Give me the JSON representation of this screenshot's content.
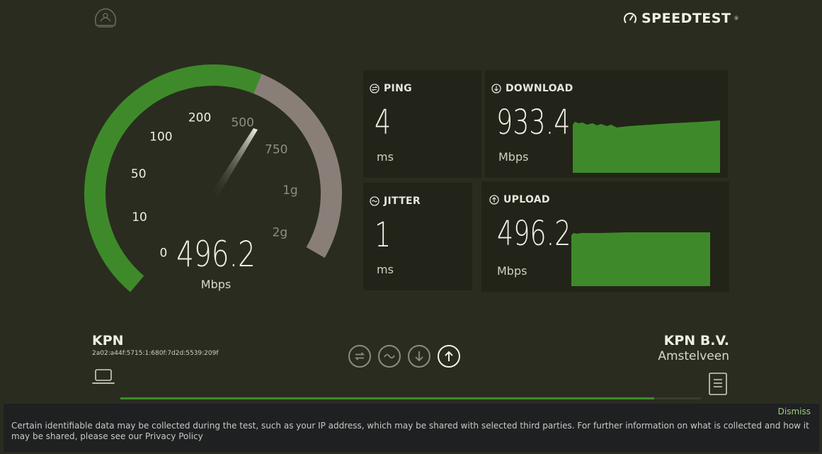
{
  "brand": {
    "name": "SPEEDTEST",
    "mark": "®"
  },
  "gauge": {
    "value": "496.2",
    "unit": "Mbps",
    "ticks": [
      "0",
      "10",
      "50",
      "100",
      "200",
      "500",
      "750",
      "1g",
      "2g"
    ],
    "colors": {
      "filled": "#3e8a2a",
      "remaining": "#8a7f78"
    }
  },
  "ping": {
    "label": "PING",
    "value": "4",
    "unit": "ms"
  },
  "jitter": {
    "label": "JITTER",
    "value": "1",
    "unit": "ms"
  },
  "download": {
    "label": "DOWNLOAD",
    "value": "933.4",
    "unit": "Mbps"
  },
  "upload": {
    "label": "UPLOAD",
    "value": "496.2",
    "unit": "Mbps"
  },
  "client": {
    "isp": "KPN",
    "ip": "2a02:a44f:5715:1:680f:7d2d:5539:209f"
  },
  "server": {
    "name": "KPN B.V.",
    "location": "Amstelveen"
  },
  "progress": {
    "fraction": 0.92
  },
  "cookie": {
    "dismiss": "Dismiss",
    "text": "Certain identifiable data may be collected during the test, such as your IP address, which may be shared with selected third parties. For further information on what is collected and how it may be shared, please see our Privacy Policy"
  },
  "icons": {
    "logo": "crest-logo-icon",
    "brand": "speedometer-icon",
    "ping": "ping-icon",
    "jitter": "jitter-icon",
    "download": "download-icon",
    "upload": "upload-icon",
    "client": "laptop-icon",
    "server": "server-icon"
  },
  "accent": "#3e8a2a"
}
